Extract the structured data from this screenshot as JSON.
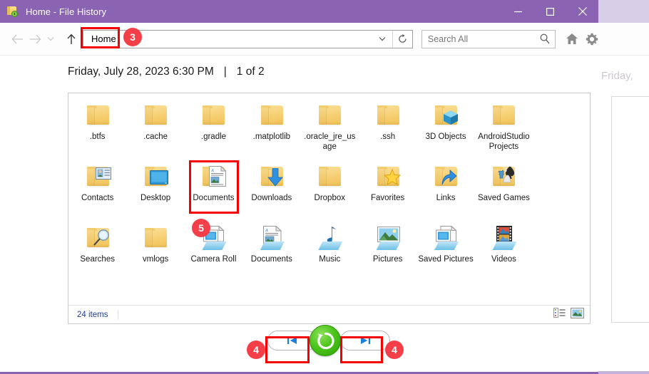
{
  "window": {
    "title": "Home - File History",
    "app_icon": "folder-history-icon",
    "controls": {
      "minimize": "minimize-button",
      "maximize": "maximize-button",
      "close": "close-button"
    },
    "accent_color": "#8a63b3"
  },
  "toolbar": {
    "back": "back-button",
    "forward": "forward-button",
    "recent": "recent-locations-button",
    "up": "up-one-level-button",
    "address_crumb": "Home",
    "address_dropdown": "address-dropdown-button",
    "refresh": "refresh-button",
    "home_icon": "home-icon",
    "settings_icon": "gear-icon"
  },
  "search": {
    "placeholder": "Search All",
    "value": "",
    "icon": "search-icon"
  },
  "header": {
    "date": "Friday, July 28, 2023 6:30 PM",
    "separator": "|",
    "position": "1 of 2"
  },
  "items": [
    {
      "label": ".btfs",
      "type": "folder"
    },
    {
      "label": ".cache",
      "type": "folder"
    },
    {
      "label": ".gradle",
      "type": "folder"
    },
    {
      "label": ".matplotlib",
      "type": "folder"
    },
    {
      "label": ".oracle_jre_usage",
      "type": "folder"
    },
    {
      "label": ".ssh",
      "type": "folder"
    },
    {
      "label": "3D Objects",
      "type": "folder-3d"
    },
    {
      "label": "AndroidStudioProjects",
      "type": "folder"
    },
    {
      "label": "Contacts",
      "type": "folder-contacts"
    },
    {
      "label": "Desktop",
      "type": "folder-desktop"
    },
    {
      "label": "Documents",
      "type": "folder-documents"
    },
    {
      "label": "Downloads",
      "type": "folder-downloads"
    },
    {
      "label": "Dropbox",
      "type": "folder"
    },
    {
      "label": "Favorites",
      "type": "folder-favorites"
    },
    {
      "label": "Links",
      "type": "folder-links"
    },
    {
      "label": "Saved Games",
      "type": "folder-savedgames"
    },
    {
      "label": "Searches",
      "type": "folder-searches"
    },
    {
      "label": "vmlogs",
      "type": "folder"
    },
    {
      "label": "Camera Roll",
      "type": "library-camera"
    },
    {
      "label": "Documents",
      "type": "library-documents"
    },
    {
      "label": "Music",
      "type": "library-music"
    },
    {
      "label": "Pictures",
      "type": "library-pictures"
    },
    {
      "label": "Saved Pictures",
      "type": "library-savedpictures"
    },
    {
      "label": "Videos",
      "type": "library-videos"
    }
  ],
  "status": {
    "item_count": "24 items",
    "view_details": "details-view-button",
    "view_large_icons": "large-icons-view-button"
  },
  "bottom_controls": {
    "previous": "previous-version-button",
    "restore": "restore-button",
    "next": "next-version-button"
  },
  "annotations": [
    {
      "number": "3",
      "target": "address-crumb"
    },
    {
      "number": "5",
      "target": "music-item"
    },
    {
      "number": "4",
      "target": "previous-version-button"
    },
    {
      "number": "4",
      "target": "next-version-button"
    }
  ],
  "background_window": {
    "date_fragment": "Friday,"
  }
}
